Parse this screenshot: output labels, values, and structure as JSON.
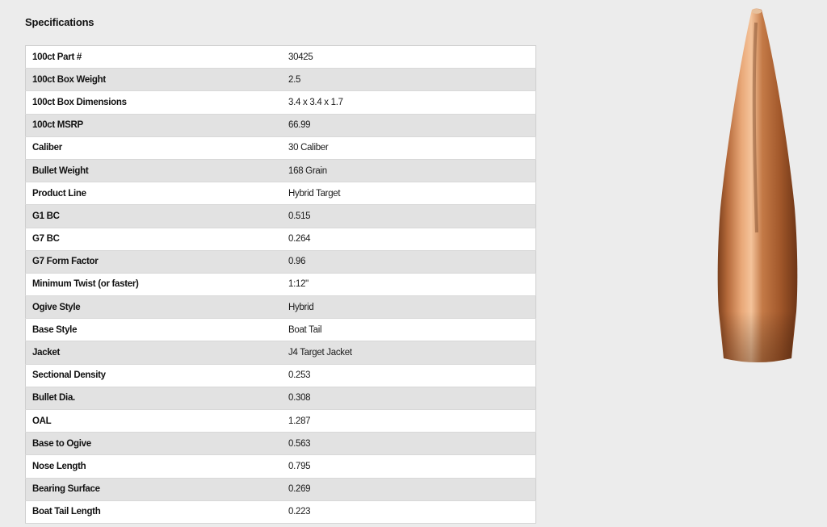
{
  "section_title": "Specifications",
  "colors": {
    "background": "#ececec",
    "row_even": "#ffffff",
    "row_odd": "#e2e2e2",
    "bullet_copper": "#c8804a"
  },
  "specs": [
    {
      "label": "100ct Part #",
      "value": "30425"
    },
    {
      "label": "100ct Box Weight",
      "value": "2.5"
    },
    {
      "label": "100ct Box Dimensions",
      "value": "3.4 x 3.4 x 1.7"
    },
    {
      "label": "100ct MSRP",
      "value": "66.99"
    },
    {
      "label": "Caliber",
      "value": "30 Caliber"
    },
    {
      "label": "Bullet Weight",
      "value": "168 Grain"
    },
    {
      "label": "Product Line",
      "value": "Hybrid Target"
    },
    {
      "label": "G1 BC",
      "value": "0.515"
    },
    {
      "label": "G7 BC",
      "value": "0.264"
    },
    {
      "label": "G7 Form Factor",
      "value": "0.96"
    },
    {
      "label": "Minimum Twist (or faster)",
      "value": "1:12\""
    },
    {
      "label": "Ogive Style",
      "value": "Hybrid"
    },
    {
      "label": "Base Style",
      "value": "Boat Tail"
    },
    {
      "label": "Jacket",
      "value": "J4 Target Jacket"
    },
    {
      "label": "Sectional Density",
      "value": "0.253"
    },
    {
      "label": "Bullet Dia.",
      "value": "0.308"
    },
    {
      "label": "OAL",
      "value": "1.287"
    },
    {
      "label": "Base to Ogive",
      "value": "0.563"
    },
    {
      "label": "Nose Length",
      "value": "0.795"
    },
    {
      "label": "Bearing Surface",
      "value": "0.269"
    },
    {
      "label": "Boat Tail Length",
      "value": "0.223"
    }
  ],
  "product_image": {
    "icon": "bullet-icon"
  }
}
